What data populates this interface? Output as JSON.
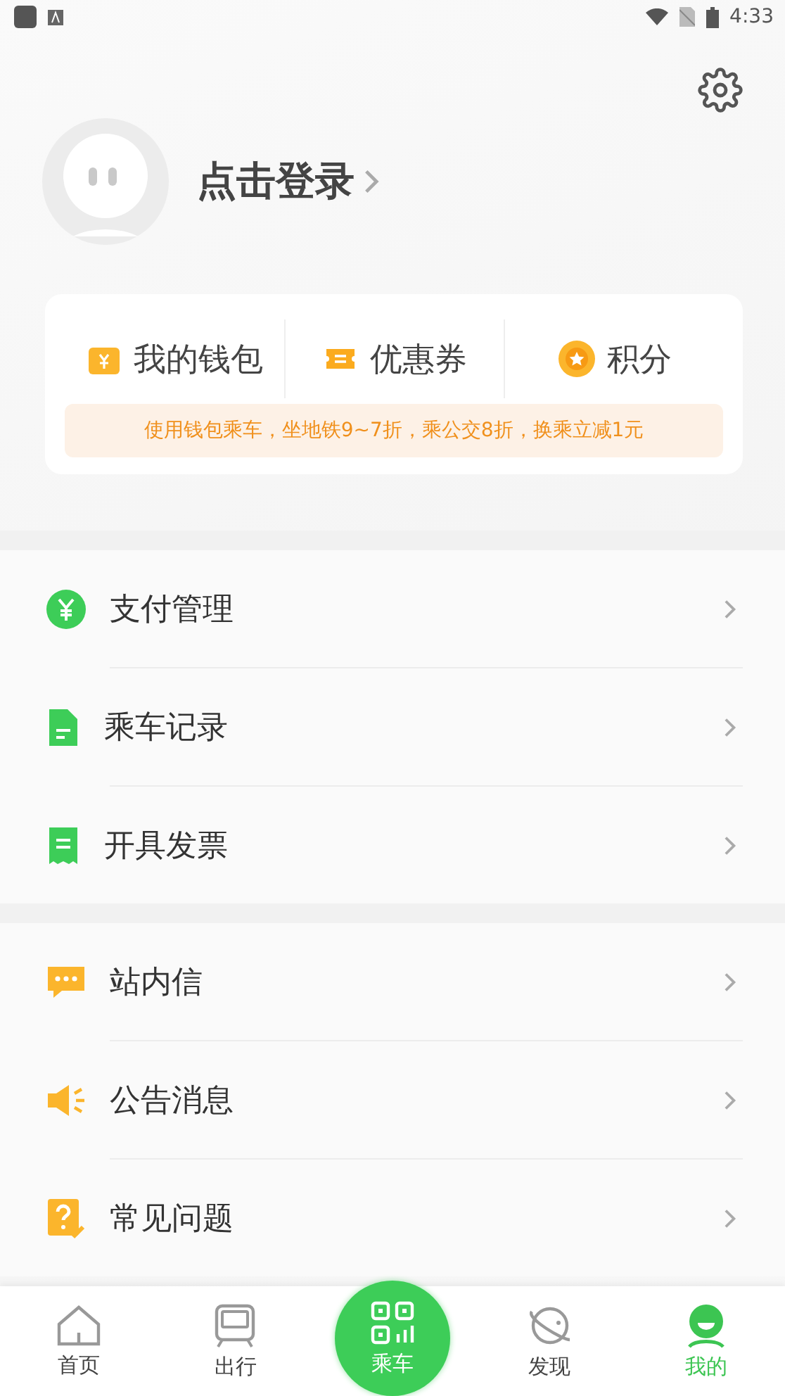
{
  "status_bar": {
    "time": "4:33"
  },
  "profile": {
    "login_label": "点击登录"
  },
  "wallet_card": {
    "items": [
      {
        "kind": "wallet",
        "label": "我的钱包"
      },
      {
        "kind": "coupon",
        "label": "优惠券"
      },
      {
        "kind": "points",
        "label": "积分"
      }
    ],
    "promo": "使用钱包乘车，坐地铁9~7折，乘公交8折，换乘立减1元"
  },
  "menu_groups": [
    [
      {
        "kind": "payment",
        "label": "支付管理"
      },
      {
        "kind": "record",
        "label": "乘车记录"
      },
      {
        "kind": "invoice",
        "label": "开具发票"
      }
    ],
    [
      {
        "kind": "message",
        "label": "站内信"
      },
      {
        "kind": "notice",
        "label": "公告消息"
      },
      {
        "kind": "faq",
        "label": "常见问题"
      }
    ]
  ],
  "tab_bar": [
    {
      "kind": "home",
      "label": "首页",
      "selected": false
    },
    {
      "kind": "travel",
      "label": "出行",
      "selected": false
    },
    {
      "kind": "ride",
      "label": "乘车",
      "selected": false
    },
    {
      "kind": "discover",
      "label": "发现",
      "selected": false
    },
    {
      "kind": "me",
      "label": "我的",
      "selected": true
    }
  ]
}
